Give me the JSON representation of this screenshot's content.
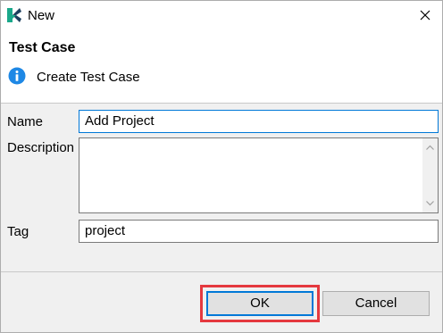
{
  "window": {
    "title": "New",
    "close_icon": "close-icon",
    "logo_icon": "katalon-logo"
  },
  "header": {
    "title": "Test Case",
    "message": "Create Test Case",
    "message_icon": "info-icon"
  },
  "form": {
    "name_label": "Name",
    "name_value": "Add Project",
    "description_label": "Description",
    "description_value": "",
    "tag_label": "Tag",
    "tag_value": "project"
  },
  "buttons": {
    "ok_label": "OK",
    "cancel_label": "Cancel"
  },
  "colors": {
    "accent": "#0078d7",
    "info": "#1e88e5",
    "highlight": "#e5393f",
    "logo_dark": "#1c3f5e",
    "logo_green": "#1aa88a"
  }
}
